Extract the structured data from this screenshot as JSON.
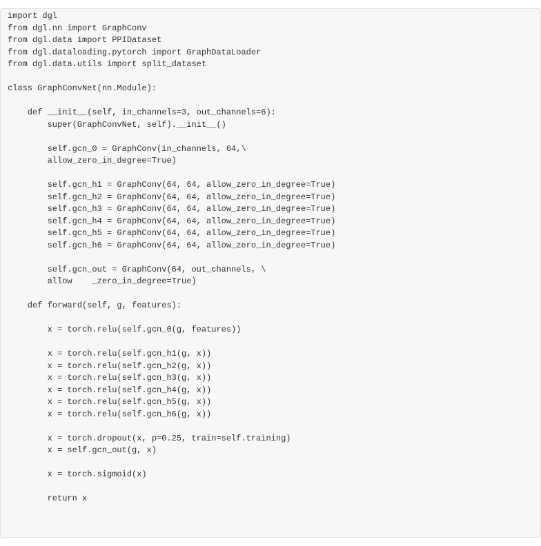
{
  "code": {
    "lines": [
      "import dgl",
      "from dgl.nn import GraphConv",
      "from dgl.data import PPIDataset",
      "from dgl.dataloading.pytorch import GraphDataLoader",
      "from dgl.data.utils import split_dataset",
      "",
      "class GraphConvNet(nn.Module):",
      "",
      "    def __init__(self, in_channels=3, out_channels=6):",
      "        super(GraphConvNet, self).__init__()",
      "",
      "        self.gcn_0 = GraphConv(in_channels, 64,\\",
      "        allow_zero_in_degree=True)",
      "",
      "        self.gcn_h1 = GraphConv(64, 64, allow_zero_in_degree=True)",
      "        self.gcn_h2 = GraphConv(64, 64, allow_zero_in_degree=True)",
      "        self.gcn_h3 = GraphConv(64, 64, allow_zero_in_degree=True)",
      "        self.gcn_h4 = GraphConv(64, 64, allow_zero_in_degree=True)",
      "        self.gcn_h5 = GraphConv(64, 64, allow_zero_in_degree=True)",
      "        self.gcn_h6 = GraphConv(64, 64, allow_zero_in_degree=True)",
      "",
      "        self.gcn_out = GraphConv(64, out_channels, \\",
      "        allow    _zero_in_degree=True)",
      "",
      "    def forward(self, g, features):",
      "",
      "        x = torch.relu(self.gcn_0(g, features))",
      "",
      "        x = torch.relu(self.gcn_h1(g, x))",
      "        x = torch.relu(self.gcn_h2(g, x))",
      "        x = torch.relu(self.gcn_h3(g, x))",
      "        x = torch.relu(self.gcn_h4(g, x))",
      "        x = torch.relu(self.gcn_h5(g, x))",
      "        x = torch.relu(self.gcn_h6(g, x))",
      "",
      "        x = torch.dropout(x, p=0.25, train=self.training)",
      "        x = self.gcn_out(g, x)",
      "",
      "        x = torch.sigmoid(x)",
      "",
      "        return x"
    ]
  }
}
